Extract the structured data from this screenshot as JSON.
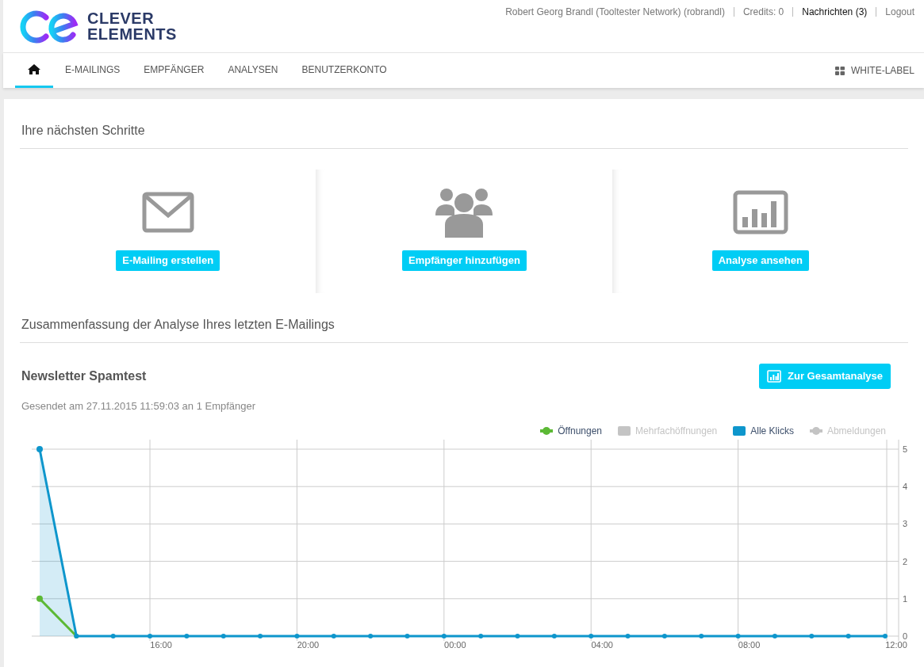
{
  "logo": {
    "lines": [
      "CLEVER",
      "ELEMENTS"
    ]
  },
  "top_links": [
    {
      "label": "Robert Georg Brandl (Tooltester Network) (robrandl)",
      "emphasis": false
    },
    {
      "label": "Credits: 0",
      "emphasis": false
    },
    {
      "label": "Nachrichten (3)",
      "emphasis": true
    },
    {
      "label": "Logout",
      "emphasis": false
    }
  ],
  "nav": {
    "tabs": [
      {
        "kind": "home",
        "selected": true
      },
      {
        "kind": "text",
        "label": "E-MAILINGS",
        "selected": false
      },
      {
        "kind": "text",
        "label": "EMPFÄNGER",
        "selected": false
      },
      {
        "kind": "text",
        "label": "ANALYSEN",
        "selected": false
      },
      {
        "kind": "text",
        "label": "BENUTZERKONTO",
        "selected": false
      }
    ],
    "right_link": "WHITE-LABEL"
  },
  "next_steps": {
    "title": "Ihre nächsten Schritte",
    "items": [
      {
        "kind": "envelope",
        "button": "E-Mailing erstellen"
      },
      {
        "kind": "people",
        "button": "Empfänger hinzufügen"
      },
      {
        "kind": "chart",
        "button": "Analyse ansehen"
      }
    ]
  },
  "summary": {
    "title": "Zusammenfassung der Analyse Ihres letzten E-Mailings",
    "mailing_name": "Newsletter Spamtest",
    "sent_info": "Gesendet am 27.11.2015 11:59:03 an 1 Empfänger",
    "button": "Zur Gesamtanalyse",
    "legend": [
      {
        "kind": "line",
        "enabled": true
      },
      {
        "name": "Mehrfachöffnungen",
        "kind": "box",
        "enabled": false
      },
      {
        "kind": "box",
        "enabled": true
      },
      {
        "name": "Abmeldungen",
        "kind": "line",
        "enabled": false
      }
    ],
    "chart_data": {
      "type": "line",
      "categories": [
        null,
        null,
        null,
        "16:00",
        null,
        null,
        null,
        "20:00",
        null,
        null,
        null,
        "00:00",
        null,
        null,
        null,
        "04:00",
        null,
        null,
        null,
        "08:00",
        null,
        null,
        null,
        "12:00"
      ],
      "ylim": [
        0,
        5
      ],
      "grid": true,
      "yticks": [
        0,
        1,
        2,
        3,
        4,
        5
      ],
      "series": [
        {
          "name": "Öffnungen",
          "color": "#5cb935",
          "marker": true,
          "values": [
            1,
            0,
            null,
            null,
            null,
            null,
            null,
            null,
            null,
            null,
            null,
            null,
            null,
            null,
            null,
            null,
            null,
            null,
            null,
            null,
            null,
            null,
            null,
            null
          ]
        },
        {
          "name": "Alle Klicks",
          "color": "#0e96cc",
          "marker": true,
          "values": [
            5,
            0,
            0,
            0,
            0,
            0,
            0,
            0,
            0,
            0,
            0,
            0,
            0,
            0,
            0,
            0,
            0,
            0,
            0,
            0,
            0,
            0,
            0,
            0
          ]
        }
      ]
    }
  }
}
